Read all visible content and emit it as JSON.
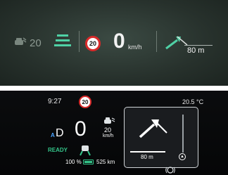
{
  "hud": {
    "acc_speed": "20",
    "speed_limit": "20",
    "speed": "0",
    "speed_unit": "km/h",
    "nav_distance": "80 m"
  },
  "cluster": {
    "time": "9:27",
    "speed_limit": "20",
    "temperature": "20.5 °C",
    "gear_auto_label": "A",
    "gear": "D",
    "speed": "0",
    "acc_speed": "20",
    "acc_unit": "km/h",
    "ready_label": "READY",
    "battery_percent": "100 %",
    "range": "525 km",
    "nav_distance": "80 m"
  },
  "colors": {
    "accent_green": "#3fd29a",
    "limit_red": "#d92a2a",
    "ready_green": "#34c58a"
  }
}
